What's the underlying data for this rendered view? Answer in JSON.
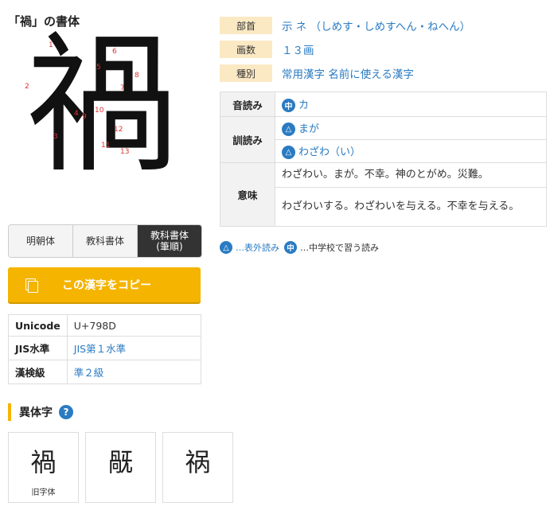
{
  "page_title": "「禍」の書体",
  "kanji": "禍",
  "stroke_numbers": [
    "1",
    "2",
    "3",
    "4",
    "5",
    "6",
    "7",
    "8",
    "9",
    "10",
    "11",
    "12",
    "13"
  ],
  "font_tabs": [
    {
      "label": "明朝体",
      "active": false
    },
    {
      "label": "教科書体",
      "active": false
    },
    {
      "label": "教科書体\n(筆順)",
      "active": true
    }
  ],
  "copy_button": "この漢字をコピー",
  "codes": [
    {
      "key": "Unicode",
      "value": "U+798D",
      "link": false
    },
    {
      "key": "JIS水準",
      "value": "JIS第１水準",
      "link": true
    },
    {
      "key": "漢検級",
      "value": "準２級",
      "link": true
    }
  ],
  "variants": {
    "title": "異体字",
    "help": "?",
    "items": [
      {
        "char": "禍",
        "note": "旧字体"
      },
      {
        "char": "旤",
        "note": ""
      },
      {
        "char": "祸",
        "note": ""
      }
    ]
  },
  "info": {
    "radical_label": "部首",
    "radical_value": "示 ネ （しめす・しめすへん・ねへん）",
    "strokes_label": "画数",
    "strokes_value": "１３画",
    "type_label": "種別",
    "type_value": "常用漢字 名前に使える漢字"
  },
  "readings": {
    "on_label": "音読み",
    "on": [
      {
        "badge": "中",
        "text": "カ"
      }
    ],
    "kun_label": "訓読み",
    "kun": [
      {
        "badge": "△",
        "text": "まが"
      },
      {
        "badge": "△",
        "text": "わざわ（い）"
      }
    ],
    "meaning_label": "意味",
    "meanings": [
      "わざわい。まが。不幸。神のとがめ。災難。",
      "わざわいする。わざわいを与える。不幸を与える。"
    ]
  },
  "legend": {
    "badge1": "△",
    "text1": "…表外読み",
    "badge2": "中",
    "text2": "…中学校で習う読み"
  },
  "colors": {
    "accent": "#f5b400",
    "link": "#2a7bc2",
    "label_bg": "#fbe9c4"
  }
}
